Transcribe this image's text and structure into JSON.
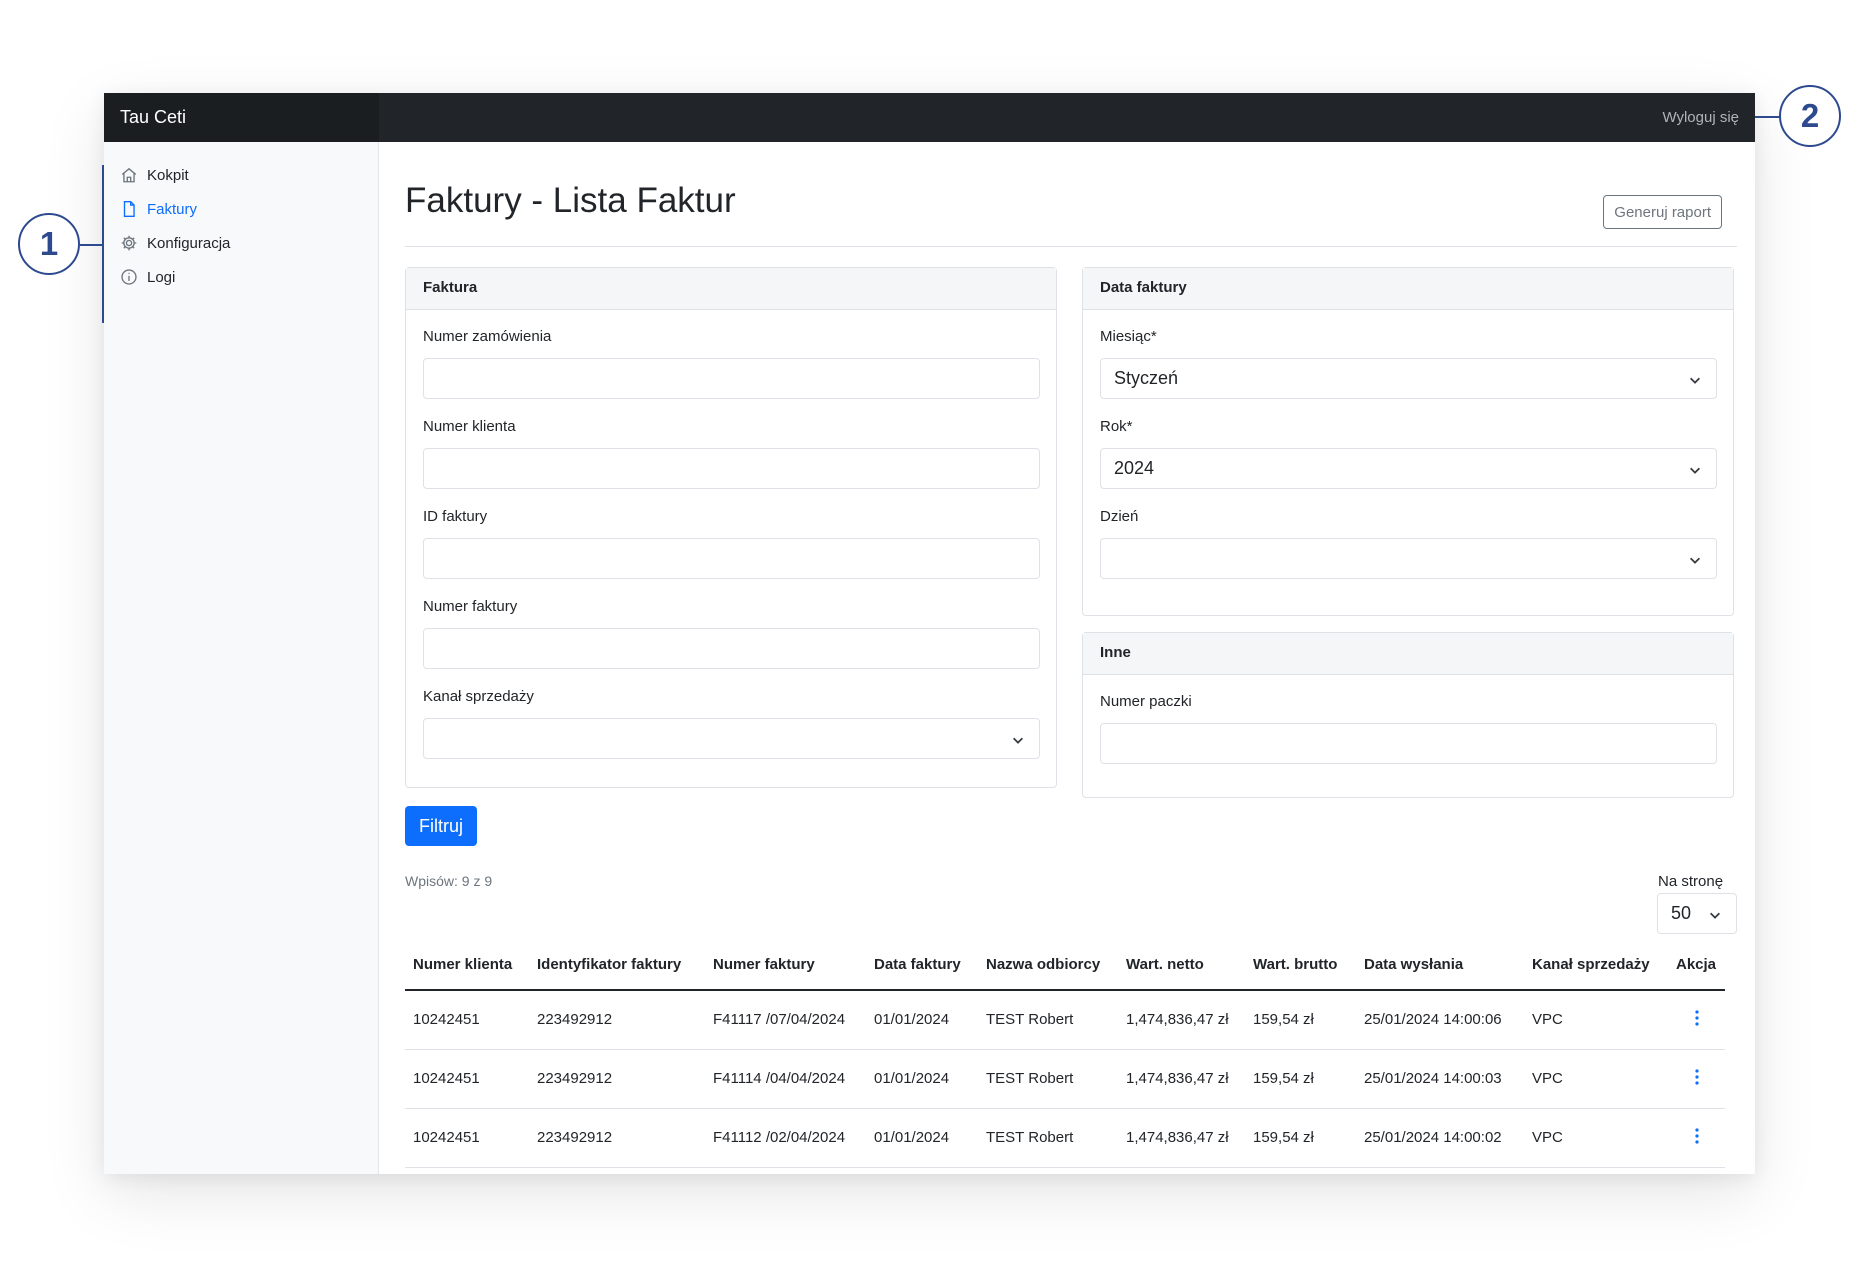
{
  "topbar": {
    "brand": "Tau Ceti",
    "logout": "Wyloguj się"
  },
  "sidebar": {
    "items": [
      {
        "label": "Kokpit",
        "icon": "home-icon",
        "active": false
      },
      {
        "label": "Faktury",
        "icon": "file-icon",
        "active": true
      },
      {
        "label": "Konfiguracja",
        "icon": "gear-icon",
        "active": false
      },
      {
        "label": "Logi",
        "icon": "info-icon",
        "active": false
      }
    ]
  },
  "page": {
    "title": "Faktury - Lista Faktur",
    "report_button": "Generuj raport"
  },
  "faktura_card": {
    "header": "Faktura",
    "order_number_label": "Numer zamówienia",
    "order_number_value": "",
    "client_number_label": "Numer klienta",
    "client_number_value": "",
    "invoice_id_label": "ID faktury",
    "invoice_id_value": "",
    "invoice_number_label": "Numer faktury",
    "invoice_number_value": "",
    "sales_channel_label": "Kanał sprzedaży",
    "sales_channel_value": ""
  },
  "date_card": {
    "header": "Data faktury",
    "month_label": "Miesiąc*",
    "month_value": "Styczeń",
    "year_label": "Rok*",
    "year_value": "2024",
    "day_label": "Dzień",
    "day_value": ""
  },
  "other_card": {
    "header": "Inne",
    "package_label": "Numer paczki",
    "package_value": ""
  },
  "filter_button": "Filtruj",
  "records_info": "Wpisów: 9 z 9",
  "per_page": {
    "label": "Na stronę",
    "value": "50"
  },
  "table": {
    "headers": [
      "Numer klienta",
      "Identyfikator faktury",
      "Numer faktury",
      "Data faktury",
      "Nazwa odbiorcy",
      "Wart. netto",
      "Wart. brutto",
      "Data wysłania",
      "Kanał sprzedaży",
      "Akcja"
    ],
    "rows": [
      [
        "10242451",
        "223492912",
        "F41117 /07/04/2024",
        "01/01/2024",
        "TEST Robert",
        "1,474,836,47 zł",
        "159,54 zł",
        "25/01/2024 14:00:06",
        "VPC"
      ],
      [
        "10242451",
        "223492912",
        "F41114 /04/04/2024",
        "01/01/2024",
        "TEST Robert",
        "1,474,836,47 zł",
        "159,54 zł",
        "25/01/2024 14:00:03",
        "VPC"
      ],
      [
        "10242451",
        "223492912",
        "F41112 /02/04/2024",
        "01/01/2024",
        "TEST Robert",
        "1,474,836,47 zł",
        "159,54 zł",
        "25/01/2024 14:00:02",
        "VPC"
      ]
    ]
  },
  "callouts": {
    "first": "1",
    "second": "2"
  },
  "colors": {
    "primary": "#0d6efd",
    "topbar": "#212529",
    "callout": "#2e4a8f"
  }
}
